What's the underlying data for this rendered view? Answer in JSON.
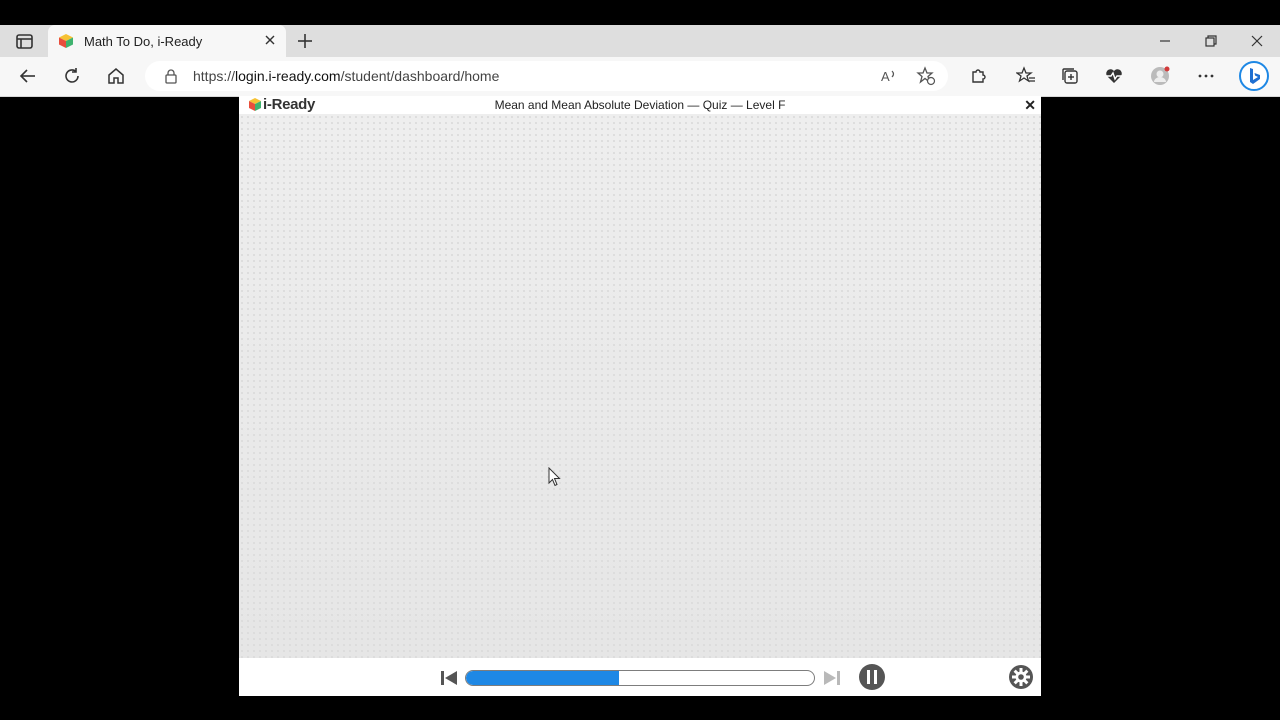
{
  "browser": {
    "tab_title": "Math To Do, i-Ready",
    "url_scheme": "https://",
    "url_host": "login.i-ready.com",
    "url_path": "/student/dashboard/home"
  },
  "app": {
    "logo_text": "i-Ready",
    "quiz_title": "Mean and Mean Absolute Deviation — Quiz — Level F",
    "close_label": "✕"
  },
  "player": {
    "progress_percent": 44
  },
  "colors": {
    "accent": "#1e88e5"
  }
}
